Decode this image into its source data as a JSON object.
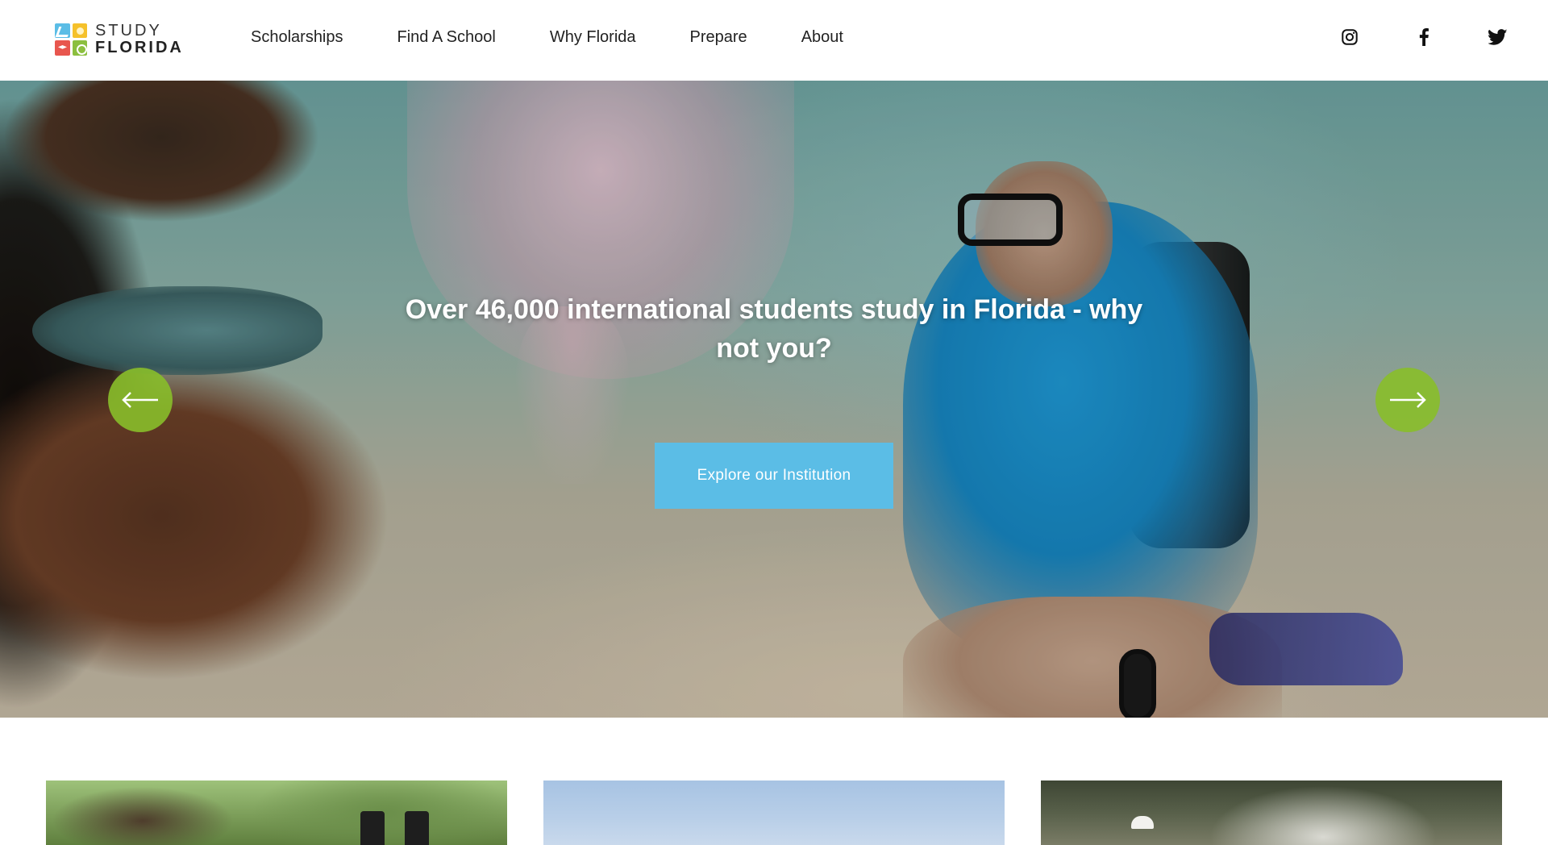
{
  "brand": {
    "line1": "STUDY",
    "line2": "FLORIDA",
    "colors": [
      "#5bbde6",
      "#f5c12b",
      "#e8564e",
      "#8cbf3f"
    ]
  },
  "nav": {
    "items": [
      {
        "label": "Scholarships"
      },
      {
        "label": "Find A School"
      },
      {
        "label": "Why Florida"
      },
      {
        "label": "Prepare"
      },
      {
        "label": "About"
      }
    ]
  },
  "social": {
    "icons": [
      "instagram-icon",
      "facebook-icon",
      "twitter-icon"
    ]
  },
  "hero": {
    "heading": "Over 46,000 international students study in Florida - why not you?",
    "cta_label": "Explore our Institution",
    "prev_icon": "arrow-left-icon",
    "next_icon": "arrow-right-icon",
    "accent": "#88be2a",
    "cta_color": "#5bbde6"
  }
}
